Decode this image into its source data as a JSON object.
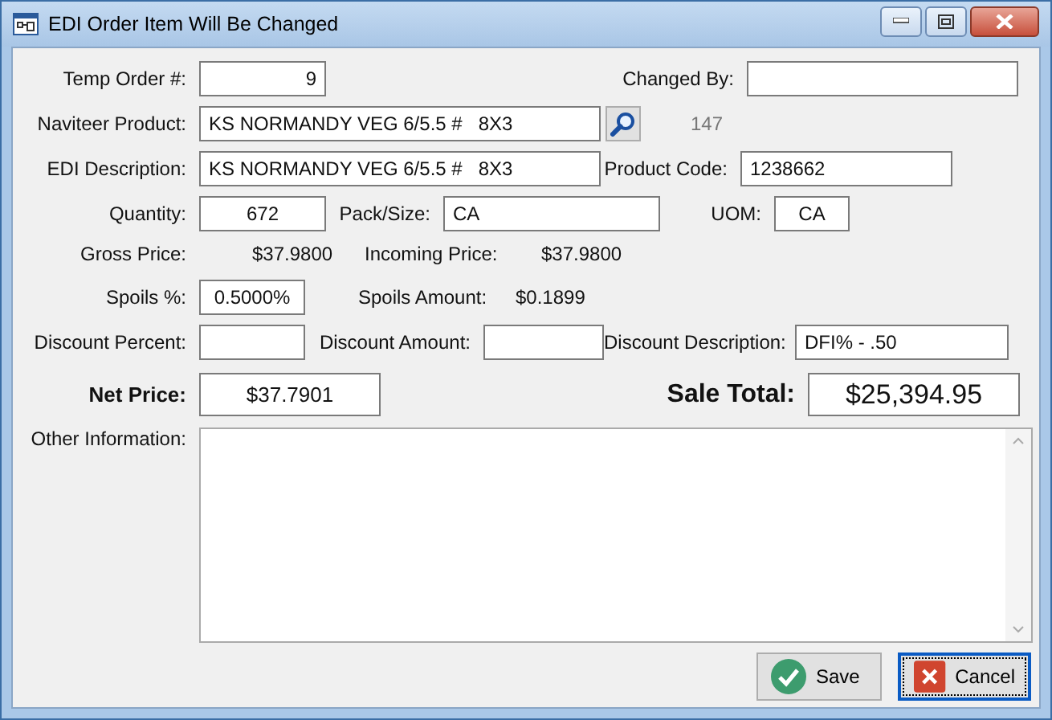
{
  "window": {
    "title": "EDI Order Item Will Be Changed"
  },
  "temp_order": {
    "label": "Temp Order #:",
    "value": "9"
  },
  "changed_by": {
    "label": "Changed By:"
  },
  "naviteer_product": {
    "label": "Naviteer Product:",
    "value": "KS NORMANDY VEG 6/5.5 #   8X3",
    "code": "147"
  },
  "edi_description": {
    "label": "EDI Description:",
    "value": "KS NORMANDY VEG 6/5.5 #   8X3"
  },
  "product_code": {
    "label": "Product Code:",
    "value": "1238662"
  },
  "quantity": {
    "label": "Quantity:",
    "value": "672"
  },
  "pack_size": {
    "label": "Pack/Size:",
    "value": "CA"
  },
  "uom": {
    "label": "UOM:",
    "value": "CA"
  },
  "gross_price": {
    "label": "Gross Price:",
    "value": "$37.9800"
  },
  "incoming_price": {
    "label": "Incoming Price:",
    "value": "$37.9800"
  },
  "spoils_percent": {
    "label": "Spoils %:",
    "value": "0.5000%"
  },
  "spoils_amount": {
    "label": "Spoils Amount:",
    "value": "$0.1899"
  },
  "discount_percent": {
    "label": "Discount Percent:"
  },
  "discount_amount": {
    "label": "Discount Amount:"
  },
  "discount_description": {
    "label": "Discount Description:",
    "value": "DFI% - .50"
  },
  "net_price": {
    "label": "Net Price:",
    "value": "$37.7901"
  },
  "sale_total": {
    "label": "Sale Total:",
    "value": "$25,394.95"
  },
  "other_information": {
    "label": "Other Information:"
  },
  "buttons": [
    {
      "label": "Save",
      "kind": "save",
      "focused": false
    },
    {
      "label": "Cancel",
      "kind": "cancel",
      "focused": true
    }
  ]
}
